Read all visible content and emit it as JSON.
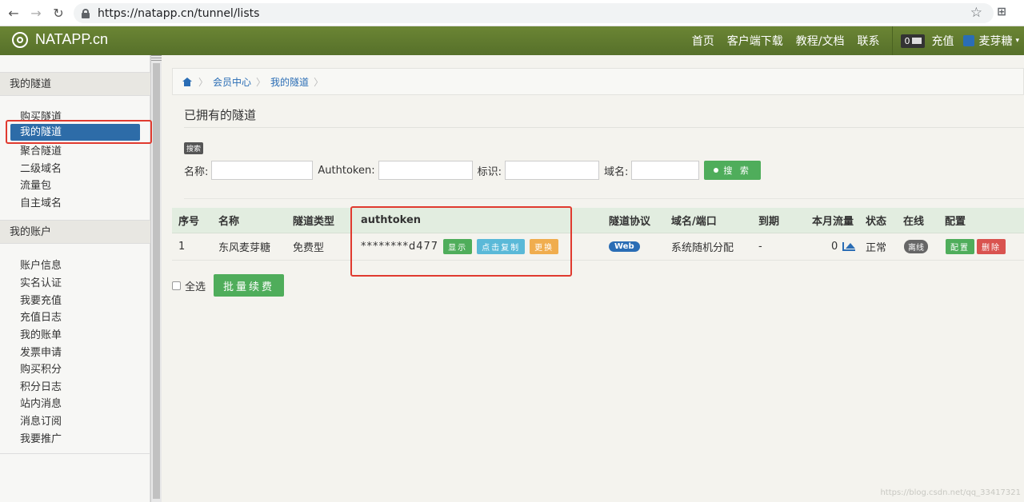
{
  "browser": {
    "url": "https://natapp.cn/tunnel/lists"
  },
  "navbar": {
    "brand": "NATAPP.cn",
    "links": [
      "首页",
      "客户端下载",
      "教程/文档",
      "联系"
    ],
    "message_count": "0",
    "recharge": "充值",
    "username": "麦芽糖"
  },
  "sidebar": {
    "group1": "我的隧道",
    "group1_items": [
      "购买隧道",
      "我的隧道",
      "聚合隧道",
      "二级域名",
      "流量包",
      "自主域名"
    ],
    "group2": "我的账户",
    "group2_items": [
      "账户信息",
      "实名认证",
      "我要充值",
      "充值日志",
      "我的账单",
      "发票申请",
      "购买积分",
      "积分日志",
      "站内消息",
      "消息订阅",
      "我要推广"
    ]
  },
  "breadcrumb": [
    "会员中心",
    "我的隧道"
  ],
  "page_title": "已拥有的隧道",
  "search": {
    "tag": "搜索",
    "name_label": "名称:",
    "authtoken_label": "Authtoken:",
    "ident_label": "标识:",
    "domain_label": "域名:",
    "button": "搜 索"
  },
  "table": {
    "headers": [
      "序号",
      "名称",
      "隧道类型",
      "authtoken",
      "隧道协议",
      "域名/端口",
      "到期",
      "本月流量",
      "状态",
      "在线",
      "配置"
    ],
    "rows": [
      {
        "index": "1",
        "name": "东风麦芽糖",
        "type": "免费型",
        "authtoken": "********d477",
        "show_btn": "显示",
        "copy_btn": "点击复制",
        "change_btn": "更换",
        "protocol": "Web",
        "domain": "系统随机分配",
        "expire": "-",
        "traffic": "0",
        "status": "正常",
        "online": "离线",
        "config_btn": "配置",
        "delete_btn": "删除"
      }
    ]
  },
  "bulk": {
    "select_all": "全选",
    "renew_btn": "批量续费"
  },
  "watermark": "https://blog.csdn.net/qq_33417321",
  "colors": {
    "navbar": "#5f7a2e",
    "active_item": "#2d6ca8",
    "highlight": "#e03a2f",
    "green_button": "#4fad5b"
  }
}
